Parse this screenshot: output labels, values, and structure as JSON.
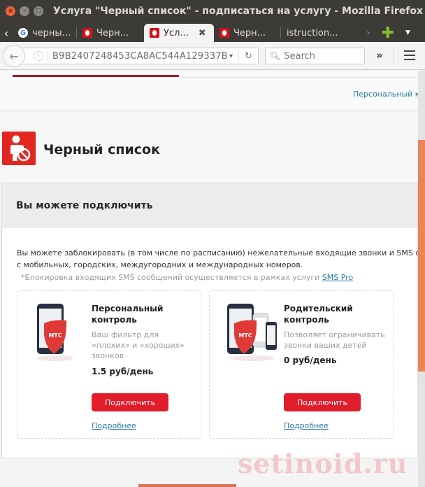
{
  "window": {
    "title": "Услуга \"Черный список\" - подписаться на услугу - Mozilla Firefox"
  },
  "tabs": [
    {
      "label": "черны...",
      "favicon": "google-icon",
      "active": false
    },
    {
      "label": "Черн...",
      "favicon": "mts-icon",
      "active": false
    },
    {
      "label": "Усл...",
      "favicon": "mts-icon",
      "active": true
    },
    {
      "label": "Черн...",
      "favicon": "mts-icon",
      "active": false
    },
    {
      "label": "istruction...",
      "favicon": "",
      "active": false
    }
  ],
  "tab_controls": {
    "scroll_left": "‹",
    "scroll_right": "›",
    "new_tab": "✚",
    "tab_list": "▼",
    "close": "✖"
  },
  "navbar": {
    "url": "B9B2407248453CA8AC544A129337B",
    "search_placeholder": "Search",
    "back": "🡐",
    "reload": "↻",
    "overflow": "»"
  },
  "page": {
    "top_nav_link": "Персональный ко",
    "title": "Черный список",
    "panel_title": "Вы можете подключить",
    "description_line1": "Вы можете заблокировать (в том числе по расписанию) нежелательные входящие звонки и SMS сообщ",
    "description_line2": "с мобильных, городских, междугородних и международных номеров.",
    "note_text": "*Блокировка входящих SMS сообщений осуществляется в рамках услуги ",
    "note_link": "SMS Pro",
    "brand_color": "#e21d2b",
    "link_color": "#2b7ea8"
  },
  "cards": [
    {
      "title": "Персональный контроль",
      "subtitle": "Ваш фильтр для «плохих» и «хороших» звонков",
      "price": "1.5 руб/день",
      "button": "Подключить",
      "more": "Подробнее",
      "shield_text": "МТС"
    },
    {
      "title": "Родительский контроль",
      "subtitle": "Позволяет ограничивать звонки ваших детей",
      "price": "0 руб/день",
      "button": "Подключить",
      "more": "Подробнее",
      "shield_text": "МТС"
    }
  ],
  "watermark": "setinoid.ru"
}
